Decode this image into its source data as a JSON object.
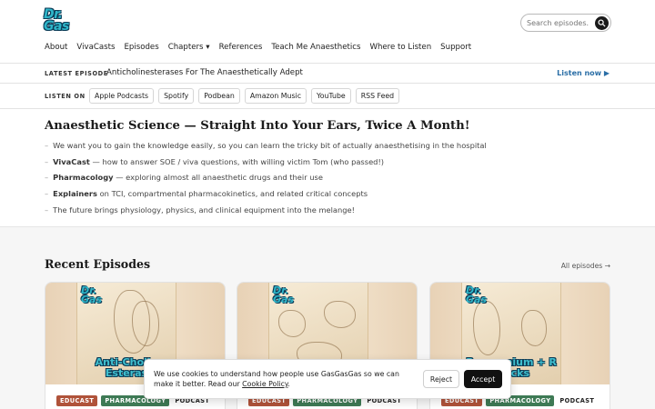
{
  "brand": {
    "logo_line1": "Dr.",
    "logo_line2": "Gas"
  },
  "search": {
    "placeholder": "Search episodes."
  },
  "nav": [
    "About",
    "VivaCasts",
    "Episodes",
    "Chapters ▾",
    "References",
    "Teach Me Anaesthetics",
    "Where to Listen",
    "Support"
  ],
  "latest": {
    "label": "LATEST EPISODE",
    "title": "Anticholinesterases For The Anaesthetically Adept",
    "cta": "Listen now ▶"
  },
  "listen_on": {
    "label": "LISTEN ON",
    "platforms": [
      "Apple Podcasts",
      "Spotify",
      "Podbean",
      "Amazon Music",
      "YouTube",
      "RSS Feed"
    ]
  },
  "hero": {
    "title": "Anaesthetic Science — Straight Into Your Ears, Twice A Month!",
    "bullets": [
      {
        "bold": "",
        "text": "We want you to gain the knowledge easily, so you can learn the tricky bit of actually anaesthetising in the hospital"
      },
      {
        "bold": "VivaCast",
        "text": " — how to answer SOE / viva questions, with willing victim Tom (who passed!)"
      },
      {
        "bold": "Pharmacology",
        "text": " — exploring almost all anaesthetic drugs and their use"
      },
      {
        "bold": "Explainers",
        "text": " on TCI, compartmental pharmacokinetics, and related critical concepts"
      },
      {
        "bold": "",
        "text": "The future brings physiology, physics, and clinical equipment into the melange!"
      }
    ]
  },
  "recent": {
    "title": "Recent Episodes",
    "all_link": "All episodes →",
    "cards": [
      {
        "art_title": "Anti-Cholin Esteras",
        "tags": [
          "EDUCAST",
          "PHARMACOLOGY",
          "PODCAST"
        ]
      },
      {
        "art_title": "",
        "tags": [
          "EDUCAST",
          "PHARMACOLOGY",
          "PODCAST"
        ]
      },
      {
        "art_title": "Rocuronium + R Blocks",
        "tags": [
          "EDUCAST",
          "PHARMACOLOGY",
          "PODCAST"
        ]
      }
    ]
  },
  "cookie": {
    "text": "We use cookies to understand how people use GasGasGas so we can make it better. Read our ",
    "link": "Cookie Policy",
    "text_end": ".",
    "reject": "Reject",
    "accept": "Accept"
  },
  "colors": {
    "accent": "#2a6ea6",
    "tag_educast": "#b0533a",
    "tag_pharmacology": "#3e7a55"
  }
}
